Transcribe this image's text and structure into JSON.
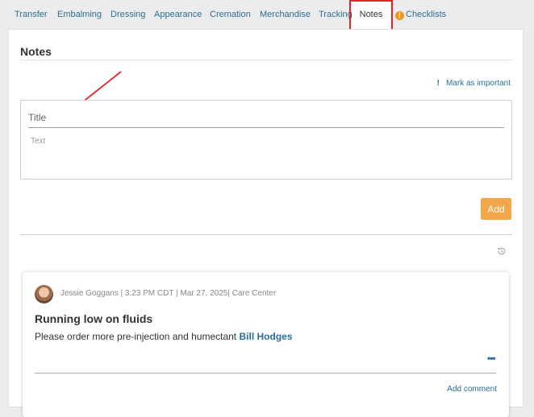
{
  "tabs": [
    {
      "label": "Transfer"
    },
    {
      "label": "Embalming"
    },
    {
      "label": "Dressing"
    },
    {
      "label": "Appearance"
    },
    {
      "label": "Cremation"
    },
    {
      "label": "Merchandise"
    },
    {
      "label": "Tracking"
    },
    {
      "label": "Notes",
      "active": true
    },
    {
      "label": "Checklists"
    }
  ],
  "page": {
    "title": "Notes"
  },
  "form": {
    "mark_important_label": "Mark as important",
    "title_placeholder": "Title",
    "text_placeholder": "Text",
    "add_label": "Add"
  },
  "note": {
    "meta": "Jessie Goggans | 3:23 PM CDT | Mar 27, 2025| Care Center",
    "title": "Running low on fluids",
    "body": "Please order more pre-injection and humectant",
    "mention": "Bill Hodges",
    "more_label": "•••",
    "add_comment_label": "Add comment"
  },
  "colors": {
    "link": "#2a6f97",
    "add_button": "#f4a74a",
    "annotation_red": "#e3262b",
    "warning": "#f0961b"
  },
  "icons": {
    "checklists_tab": "exclamation-circle-icon",
    "important": "exclamation-icon",
    "history": "history-icon"
  }
}
